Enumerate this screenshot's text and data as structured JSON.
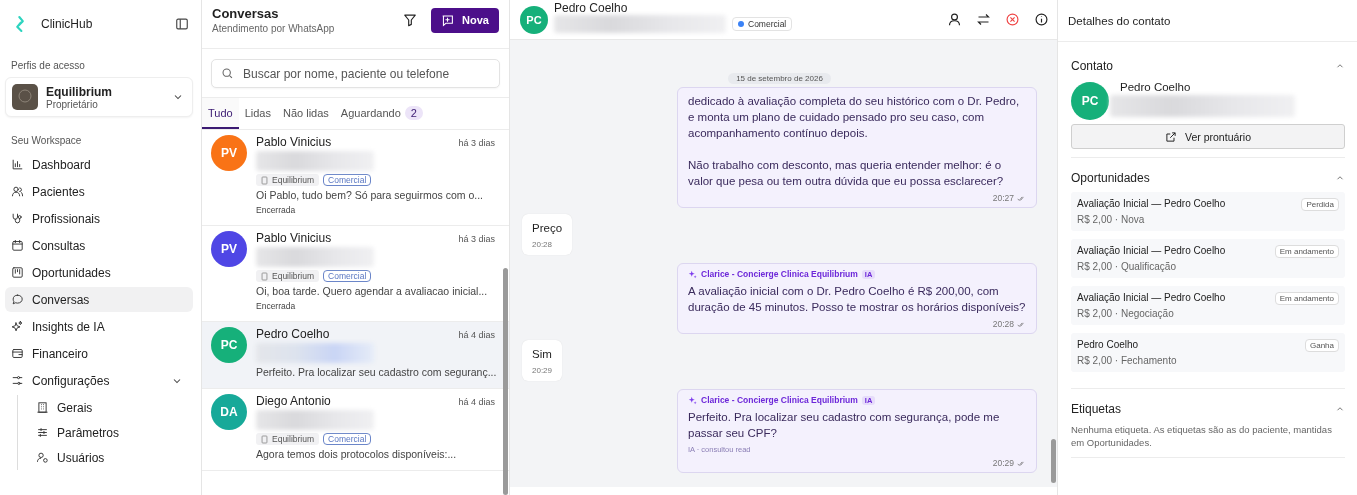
{
  "sidebar": {
    "brand": "ClinicHub",
    "profiles_label": "Perfis de acesso",
    "profile": {
      "name": "Equilibrium",
      "role": "Proprietário"
    },
    "workspace_label": "Seu Workspace",
    "items": [
      {
        "label": "Dashboard",
        "selected": false
      },
      {
        "label": "Pacientes",
        "selected": false
      },
      {
        "label": "Profissionais",
        "selected": false
      },
      {
        "label": "Consultas",
        "selected": false
      },
      {
        "label": "Oportunidades",
        "selected": false
      },
      {
        "label": "Conversas",
        "selected": true
      },
      {
        "label": "Insights de IA",
        "selected": false
      },
      {
        "label": "Financeiro",
        "selected": false
      },
      {
        "label": "Configurações",
        "selected": false,
        "expanded": true,
        "children": [
          {
            "label": "Gerais",
            "selected": false
          },
          {
            "label": "Parâmetros",
            "selected": false
          },
          {
            "label": "Usuários",
            "selected": false
          }
        ]
      }
    ]
  },
  "conversations": {
    "title": "Conversas",
    "subtitle": "Atendimento por WhatsApp",
    "new_button": "Nova",
    "search": {
      "placeholder": "Buscar por nome, paciente ou telefone"
    },
    "tabs": [
      {
        "label": "Tudo",
        "selected": true
      },
      {
        "label": "Lidas",
        "selected": false
      },
      {
        "label": "Não lidas",
        "selected": false
      },
      {
        "label": "Aguardando",
        "selected": false,
        "count": "2"
      }
    ],
    "items": [
      {
        "initials": "PV",
        "color": "#f97316",
        "name": "Pablo Vinicius",
        "time": "há 3 dias",
        "inbox": "Equilibrium",
        "tag": "Comercial",
        "preview": "Oi Pablo, tudo bem? Só para seguirmos com o...",
        "status": "Encerrada",
        "selected": false
      },
      {
        "initials": "PV",
        "color": "#4f46e5",
        "name": "Pablo Vinicius",
        "time": "há 3 dias",
        "inbox": "Equilibrium",
        "tag": "Comercial",
        "preview": "Oi, boa tarde. Quero agendar a avaliacao inicial...",
        "status": "Encerrada",
        "selected": false
      },
      {
        "initials": "PC",
        "color": "#16b07a",
        "name": "Pedro Coelho",
        "time": "há 4 dias",
        "preview": "Perfeito. Pra localizar seu cadastro com seguranç...",
        "selected": true
      },
      {
        "initials": "DA",
        "color": "#17a999",
        "name": "Diego Antonio",
        "time": "há 4 dias",
        "inbox": "Equilibrium",
        "tag": "Comercial",
        "preview": "Agora temos dois protocolos disponíveis:...",
        "selected": false
      }
    ]
  },
  "chat": {
    "contact": {
      "initials": "PC",
      "name": "Pedro Coelho",
      "tag": "Comercial"
    },
    "date": "15 de setembro de 2026",
    "messages": [
      {
        "kind": "agent",
        "paragraphs": [
          "dedicado à avaliação completa do seu histórico com o Dr. Pedro, e monta um plano de cuidado pensado pro seu caso, com acompanhamento contínuo depois.",
          "Não trabalho com desconto, mas queria entender melhor: é o valor que pesa ou tem outra dúvida que eu possa esclarecer?"
        ],
        "time": "20:27",
        "read": true
      },
      {
        "kind": "contact",
        "paragraphs": [
          "Preço"
        ],
        "time": "20:28"
      },
      {
        "kind": "agent",
        "sender": "Clarice - Concierge Clinica Equilibrium",
        "badge": "IA",
        "paragraphs": [
          "A avaliação inicial com o Dr. Pedro Coelho é R$ 200,00, com duração de 45 minutos. Posso te mostrar os horários disponíveis?"
        ],
        "time": "20:28",
        "read": true
      },
      {
        "kind": "contact",
        "paragraphs": [
          "Sim"
        ],
        "time": "20:29"
      },
      {
        "kind": "agent",
        "sender": "Clarice - Concierge Clinica Equilibrium",
        "badge": "IA",
        "paragraphs": [
          "Perfeito. Pra localizar seu cadastro com segurança, pode me passar seu CPF?"
        ],
        "note": "IA · consultou read",
        "time": "20:29",
        "read": true
      }
    ]
  },
  "details": {
    "title": "Detalhes do contato",
    "contact": {
      "heading": "Contato",
      "expanded": true,
      "initials": "PC",
      "name": "Pedro Coelho",
      "button": "Ver prontuário"
    },
    "opportunities": {
      "heading": "Oportunidades",
      "expanded": true,
      "items": [
        {
          "title": "Avaliação Inicial — Pedro Coelho",
          "detail": "R$ 2,00 · Nova",
          "status": "Perdida"
        },
        {
          "title": "Avaliação Inicial — Pedro Coelho",
          "detail": "R$ 2,00 · Qualificação",
          "status": "Em andamento"
        },
        {
          "title": "Avaliação Inicial — Pedro Coelho",
          "detail": "R$ 2,00 · Negociação",
          "status": "Em andamento"
        },
        {
          "title": "Pedro Coelho",
          "detail": "R$ 2,00 · Fechamento",
          "status": "Ganha"
        }
      ]
    },
    "labels": {
      "heading": "Etiquetas",
      "expanded": true,
      "text": "Nenhuma etiqueta. As etiquetas são as do paciente, mantidas em Oportunidades."
    }
  }
}
